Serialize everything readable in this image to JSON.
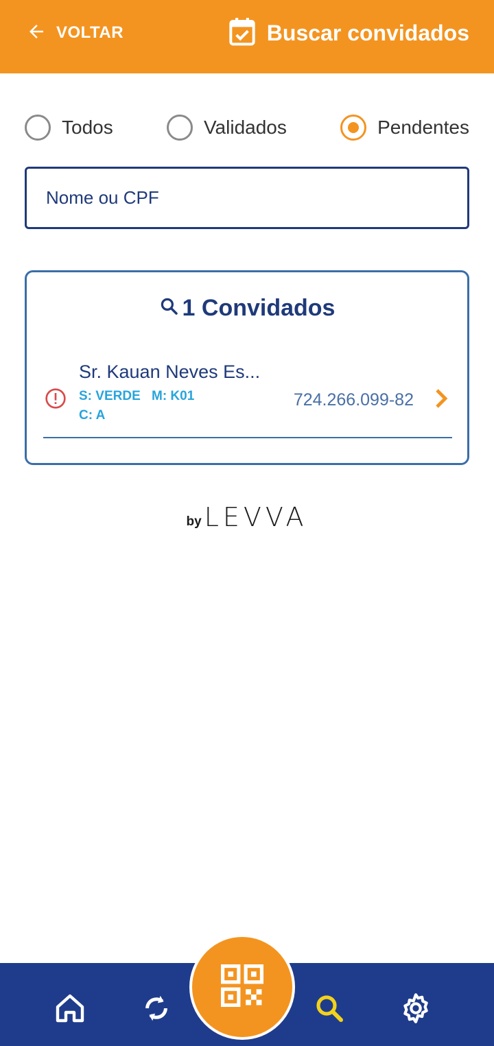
{
  "header": {
    "back_label": "VOLTAR",
    "title": "Buscar convidados",
    "bg_color": "#f39420"
  },
  "filters": {
    "options": [
      {
        "label": "Todos",
        "selected": false
      },
      {
        "label": "Validados",
        "selected": false
      },
      {
        "label": "Pendentes",
        "selected": true
      }
    ]
  },
  "search": {
    "placeholder": "Nome ou CPF",
    "value": ""
  },
  "results": {
    "title": "1 Convidados",
    "guests": [
      {
        "name": "Sr. Kauan Neves Es...",
        "sector": "S: VERDE",
        "table": "M: K01",
        "category": "C: A",
        "cpf": "724.266.099-82",
        "status_icon": "alert-circle-icon"
      }
    ]
  },
  "brand": {
    "by": "by",
    "name": "LEVVA"
  },
  "bottom_nav": {
    "bg_color": "#1f3c8c",
    "items": [
      {
        "icon": "home-icon"
      },
      {
        "icon": "sync-icon"
      },
      {
        "icon": "qr-code-icon"
      },
      {
        "icon": "search-icon",
        "active": true
      },
      {
        "icon": "gear-icon"
      }
    ]
  }
}
